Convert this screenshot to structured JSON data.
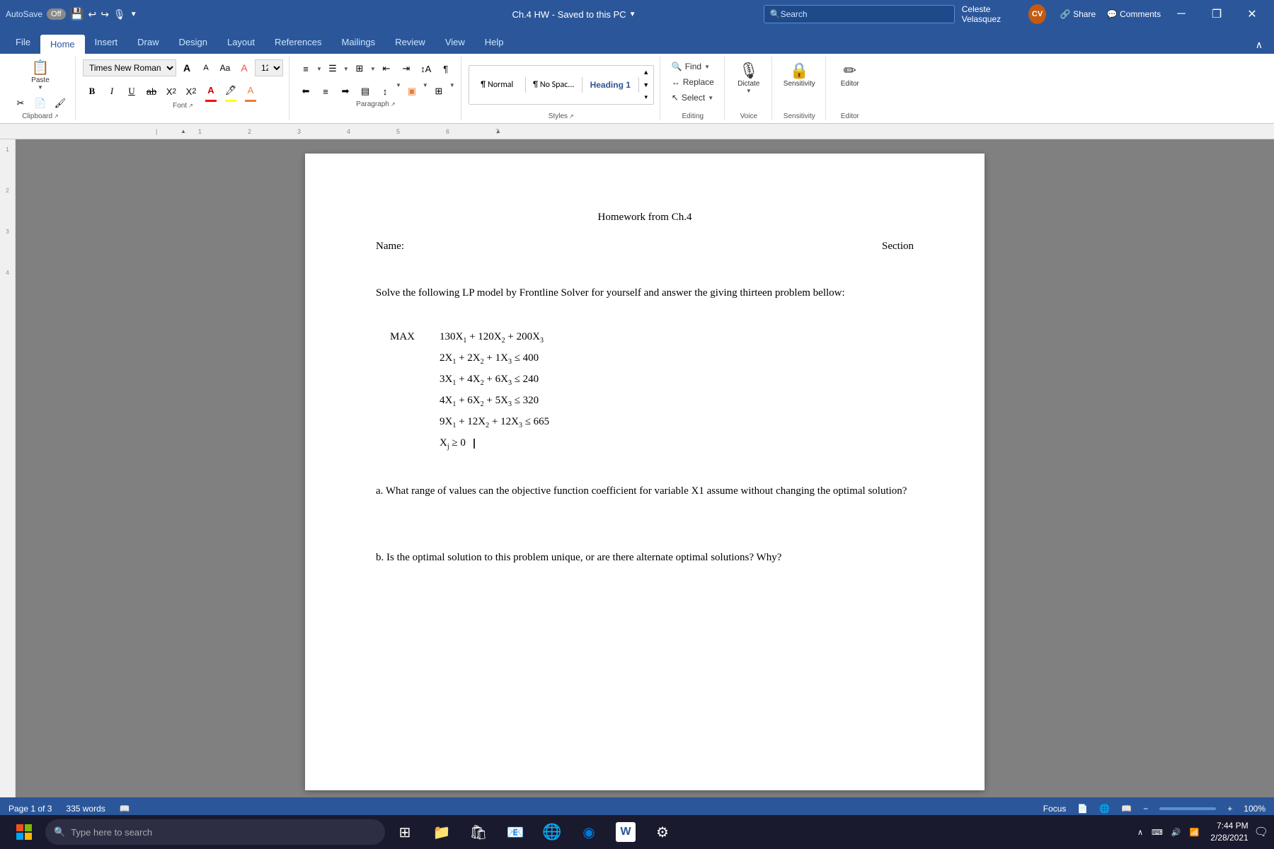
{
  "titlebar": {
    "autosave": "AutoSave",
    "toggle_state": "Off",
    "doc_title": "Ch.4 HW - Saved to this PC",
    "search_placeholder": "Search",
    "user_name": "Celeste Velasquez",
    "user_initials": "CV",
    "minimize": "─",
    "restore": "❐",
    "close": "✕"
  },
  "ribbon": {
    "tabs": [
      "File",
      "Home",
      "Insert",
      "Draw",
      "Design",
      "Layout",
      "References",
      "Mailings",
      "Review",
      "View",
      "Help"
    ],
    "active_tab": "Home"
  },
  "font_group": {
    "font_name": "Times New Roman",
    "font_size": "12",
    "label": "Font"
  },
  "styles": {
    "normal": "¶ Normal",
    "no_spacing": "¶ No Spac...",
    "heading1": "Heading 1",
    "label": "Styles"
  },
  "editing": {
    "find": "Find",
    "replace": "Replace",
    "select": "Select",
    "label": "Editing"
  },
  "document": {
    "title": "Homework from Ch.4",
    "name_label": "Name:",
    "section_label": "Section",
    "intro": "Solve the following LP model by Frontline Solver for yourself and answer the giving thirteen problem bellow:",
    "max_label": "MAX",
    "objective": "130X₁ + 120X₂ + 200X₃",
    "constraint1": "2X₁ + 2X₂ + 1X₃ ≤ 400",
    "constraint2": "3X₁ + 4X₂ + 6X₃ ≤ 240",
    "constraint3": "4X₁ + 6X₂ + 5X₃ ≤ 320",
    "constraint4": "9X₁ + 12X₂ + 12X₃ ≤ 665",
    "nonnegativity": "Xⱼ ≥ 0",
    "question_a": "a. What range of values can the objective function coefficient for variable X1 assume without changing the optimal solution?",
    "question_b": "b. Is the optimal solution to this problem unique, or are there alternate optimal solutions? Why?"
  },
  "statusbar": {
    "page": "Page 1 of 3",
    "words": "335 words",
    "focus": "Focus",
    "zoom": "100%"
  },
  "taskbar": {
    "search_placeholder": "Type here to search",
    "time": "7:44 PM",
    "date": "2/28/2021"
  }
}
